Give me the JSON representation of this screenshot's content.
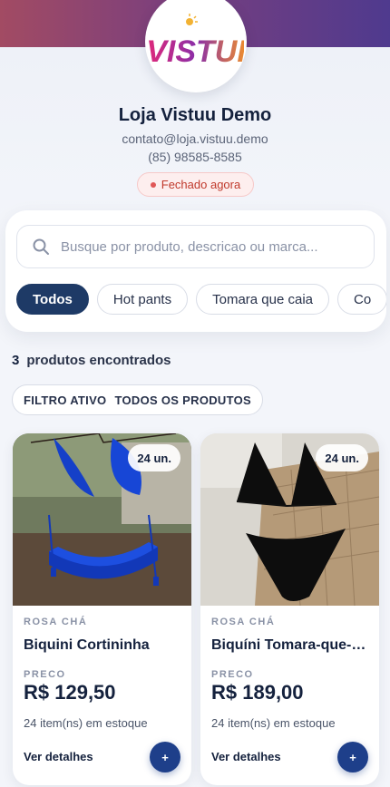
{
  "store": {
    "name": "Loja Vistuu Demo",
    "email": "contato@loja.vistuu.demo",
    "phone": "(85) 98585-8585",
    "status": "Fechado agora",
    "logo_text": "VISTUI"
  },
  "search": {
    "placeholder": "Busque por produto, descricao ou marca..."
  },
  "categories": [
    "Todos",
    "Hot pants",
    "Tomara que caia",
    "Co"
  ],
  "results": {
    "count": "3",
    "label": "produtos encontrados"
  },
  "filter": {
    "label": "FILTRO ATIVO",
    "value": "TODOS OS PRODUTOS"
  },
  "products": [
    {
      "badge": "24 un.",
      "brand": "ROSA CHÁ",
      "name": "Biquini Cortininha",
      "price_label": "PRECO",
      "price": "R$ 129,50",
      "stock": "24 item(ns) em estoque",
      "details": "Ver detalhes",
      "add": "+"
    },
    {
      "badge": "24 un.",
      "brand": "ROSA CHÁ",
      "name": "Biquíni Tomara-que-caia",
      "price_label": "PRECO",
      "price": "R$ 189,00",
      "stock": "24 item(ns) em estoque",
      "details": "Ver detalhes",
      "add": "+"
    }
  ],
  "colors": {
    "accent": "#1e3a66",
    "status": "#c0392b",
    "banner_start": "#a24b63",
    "banner_end": "#4f3a8e"
  }
}
